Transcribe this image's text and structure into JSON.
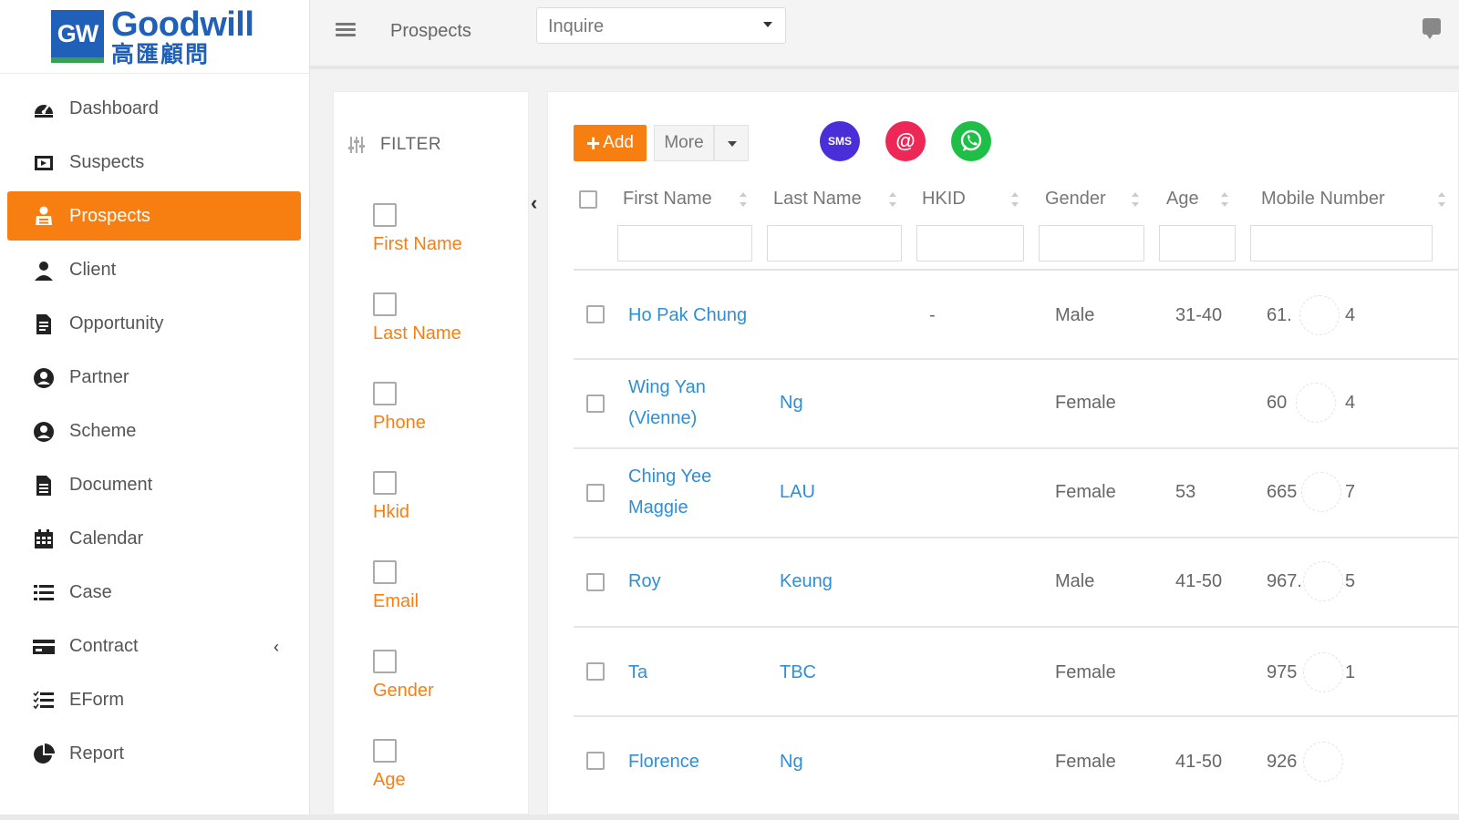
{
  "brand": {
    "logo_mark": "GW",
    "name": "Goodwill",
    "subtitle": "高匯顧問"
  },
  "sidebar": {
    "items": [
      {
        "label": "Dashboard",
        "icon": "dashboard-icon",
        "active": false
      },
      {
        "label": "Suspects",
        "icon": "suspects-icon",
        "active": false
      },
      {
        "label": "Prospects",
        "icon": "prospects-icon",
        "active": true
      },
      {
        "label": "Client",
        "icon": "user-icon",
        "active": false
      },
      {
        "label": "Opportunity",
        "icon": "document-icon",
        "active": false
      },
      {
        "label": "Partner",
        "icon": "user-circle-icon",
        "active": false
      },
      {
        "label": "Scheme",
        "icon": "user-circle-icon",
        "active": false
      },
      {
        "label": "Document",
        "icon": "file-icon",
        "active": false
      },
      {
        "label": "Calendar",
        "icon": "calendar-icon",
        "active": false
      },
      {
        "label": "Case",
        "icon": "list-icon",
        "active": false
      },
      {
        "label": "Contract",
        "icon": "credit-card-icon",
        "active": false,
        "has_submenu": true
      },
      {
        "label": "EForm",
        "icon": "checklist-icon",
        "active": false
      },
      {
        "label": "Report",
        "icon": "pie-chart-icon",
        "active": false
      }
    ]
  },
  "topbar": {
    "title": "Prospects",
    "select_value": "Inquire"
  },
  "filter": {
    "heading": "FILTER",
    "options": [
      "First Name",
      "Last Name",
      "Phone",
      "Hkid",
      "Email",
      "Gender",
      "Age"
    ]
  },
  "toolbar": {
    "add_label": "Add",
    "more_label": "More",
    "sms_label": "SMS",
    "email_label": "@"
  },
  "table": {
    "columns": [
      "First Name",
      "Last Name",
      "HKID",
      "Gender",
      "Age",
      "Mobile Number"
    ],
    "rows": [
      {
        "first_name": "Ho Pak Chung",
        "last_name": "",
        "hkid": "-",
        "gender": "Male",
        "age": "31-40",
        "mobile_start": "61.",
        "mobile_end": "4"
      },
      {
        "first_name": "Wing Yan (Vienne)",
        "last_name": "Ng",
        "hkid": "",
        "gender": "Female",
        "age": "",
        "mobile_start": "60",
        "mobile_end": "4"
      },
      {
        "first_name": "Ching Yee Maggie",
        "last_name": "LAU",
        "hkid": "",
        "gender": "Female",
        "age": "53",
        "mobile_start": "665",
        "mobile_end": "7"
      },
      {
        "first_name": "Roy",
        "last_name": "Keung",
        "hkid": "",
        "gender": "Male",
        "age": "41-50",
        "mobile_start": "967.",
        "mobile_end": "5"
      },
      {
        "first_name": "Ta",
        "last_name": "TBC",
        "hkid": "",
        "gender": "Female",
        "age": "",
        "mobile_start": "975",
        "mobile_end": "1"
      },
      {
        "first_name": "Florence",
        "last_name": "Ng",
        "hkid": "",
        "gender": "Female",
        "age": "41-50",
        "mobile_start": "926",
        "mobile_end": ""
      }
    ]
  },
  "colors": {
    "accent": "#f77f12",
    "link": "#2d8fd8",
    "brand_blue": "#2060b8",
    "sms": "#4a2fd8",
    "email": "#ee2856",
    "whatsapp": "#1fbf47"
  }
}
